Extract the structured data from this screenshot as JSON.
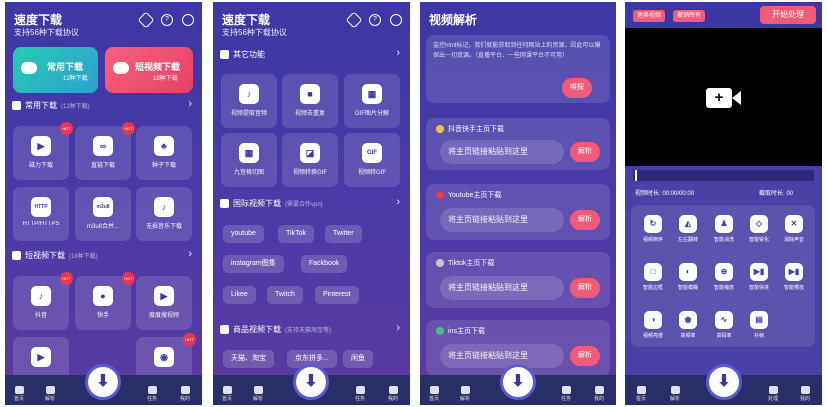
{
  "screen1": {
    "title": "速度下载",
    "subtitle": "支持56种下载协议",
    "promo": [
      {
        "label": "常用下载",
        "sub": "12种下载"
      },
      {
        "label": "短视频下载",
        "sub": "18种下载"
      }
    ],
    "section1": {
      "label": "常用下载",
      "sub": "(12种下载)"
    },
    "tiles1": [
      "磁力下载",
      "直链下载",
      "种子下载",
      "HTTP/HTTPS",
      "m3u8合并...",
      "无损音乐下载"
    ],
    "tile_hot": "HOT",
    "tile_icons": [
      "HTTP",
      "m3u8"
    ],
    "section2": {
      "label": "短视频下载",
      "sub": "(18种下载)"
    },
    "tiles2": [
      "抖音",
      "快手",
      "度度搜视频"
    ],
    "nav": [
      "首页",
      "解析",
      "任务",
      "我的"
    ]
  },
  "screen2": {
    "title": "速度下载",
    "subtitle": "支持56种下载协议",
    "section1": {
      "label": "其它功能"
    },
    "tiles": [
      "视频提取音频",
      "视频去重复",
      "GIF图片分解",
      "九宫格切图",
      "视频转换GIF",
      "视频转GIF"
    ],
    "tile_icons": [
      "GIF"
    ],
    "section2": {
      "label": "国际视频下载",
      "sub": "(需要合作vpn)"
    },
    "pills1": [
      "youtube",
      "TikTok",
      "Twitter",
      "instagram图集",
      "Fackbook",
      "Likee",
      "Twitch",
      "Pinterest"
    ],
    "section3": {
      "label": "商品视频下载",
      "sub": "(支持天猫淘宝等)"
    },
    "pills2": [
      "天猫、淘宝",
      "京东拼多...",
      "闲鱼"
    ],
    "nav": [
      "首页",
      "解析",
      "任务",
      "我的"
    ]
  },
  "screen3": {
    "title": "视频解析",
    "info": "监控html标记，我们就能获取到任何网站上的资源，因此可以爆探出一切资源。（直播平台、一些网课平台不可用）",
    "sniff_button": "嗅探",
    "cards": [
      {
        "label": "抖音快手主页下载",
        "placeholder": "将主页链接粘贴到这里"
      },
      {
        "label": "Youtube主页下载",
        "placeholder": "将主页链接粘贴到这里"
      },
      {
        "label": "Tiktok主页下载",
        "placeholder": "将主页链接粘贴到这里"
      },
      {
        "label": "ins主页下载",
        "placeholder": "将主页链接粘贴到这里"
      }
    ],
    "parse_button": "解析",
    "nav": [
      "首页",
      "解析",
      "任务",
      "我的"
    ]
  },
  "screen4": {
    "top_buttons": [
      "更换视频",
      "撤销所有"
    ],
    "start_button": "开始处理",
    "duration": "视频时长: 00:00/00:00",
    "cut_time": "截取时长: 00",
    "controls": [
      "视频倒序",
      "左右翻转",
      "智能消洗",
      "智能锐化",
      "消除声音",
      "智能边框",
      "智能模糊",
      "智能缩放",
      "智能快进",
      "智能慢放",
      "视频亮度",
      "高频率",
      "高码率",
      "补帧"
    ],
    "nav": [
      "首页",
      "解析",
      "处理",
      "我的"
    ]
  }
}
